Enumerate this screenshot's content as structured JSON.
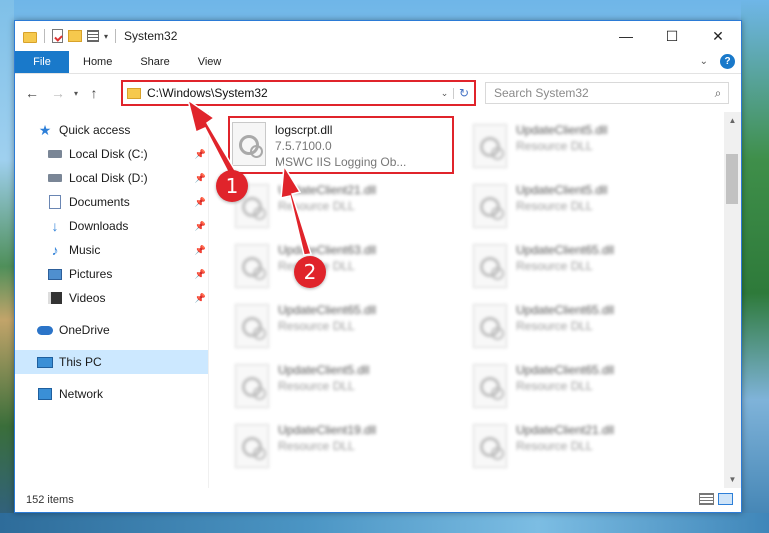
{
  "window": {
    "title": "System32",
    "controls": [
      "—",
      "☐",
      "✕"
    ]
  },
  "ribbon": {
    "file_tab": "File",
    "tabs": [
      "Home",
      "Share",
      "View"
    ],
    "help": "?"
  },
  "address": {
    "path": "C:\\Windows\\System32"
  },
  "search": {
    "placeholder": "Search System32"
  },
  "sidebar": {
    "items": [
      {
        "label": "Quick access",
        "icon": "star-icon"
      },
      {
        "label": "Local Disk (C:)",
        "icon": "disk-icon",
        "pinned": true
      },
      {
        "label": "Local Disk (D:)",
        "icon": "disk-icon",
        "pinned": true
      },
      {
        "label": "Documents",
        "icon": "documents-icon",
        "pinned": true
      },
      {
        "label": "Downloads",
        "icon": "download-icon",
        "pinned": true
      },
      {
        "label": "Music",
        "icon": "music-icon",
        "pinned": true
      },
      {
        "label": "Pictures",
        "icon": "pictures-icon",
        "pinned": true
      },
      {
        "label": "Videos",
        "icon": "videos-icon",
        "pinned": true
      },
      {
        "label": "OneDrive",
        "icon": "onedrive-icon"
      },
      {
        "label": "This PC",
        "icon": "this-pc-icon",
        "selected": true
      },
      {
        "label": "Network",
        "icon": "network-icon"
      }
    ]
  },
  "files": [
    {
      "name": "logscrpt.dll",
      "version": "7.5.7100.0",
      "desc": "MSWC IIS Logging Ob..."
    },
    {
      "name": "UpdateClient5.dll",
      "desc": "Resource DLL"
    },
    {
      "name": "UpdateClient21.dll",
      "desc": "Resource DLL"
    },
    {
      "name": "UpdateClient5.dll",
      "desc": "Resource DLL"
    },
    {
      "name": "UpdateClient63.dll",
      "desc": "Resource DLL"
    },
    {
      "name": "UpdateClient65.dll",
      "desc": "Resource DLL"
    },
    {
      "name": "UpdateClient65.dll",
      "desc": "Resource DLL"
    },
    {
      "name": "UpdateClient65.dll",
      "desc": "Resource DLL"
    },
    {
      "name": "UpdateClient5.dll",
      "desc": "Resource DLL"
    },
    {
      "name": "UpdateClient65.dll",
      "desc": "Resource DLL"
    },
    {
      "name": "UpdateClient19.dll",
      "desc": "Resource DLL"
    },
    {
      "name": "UpdateClient21.dll",
      "desc": "Resource DLL"
    }
  ],
  "status": {
    "item_count": "152 items"
  },
  "annotations": {
    "step1": "1",
    "step2": "2",
    "color": "#e0242b"
  },
  "colors": {
    "accent": "#1979ca",
    "selected_nav": "#cce8ff"
  }
}
